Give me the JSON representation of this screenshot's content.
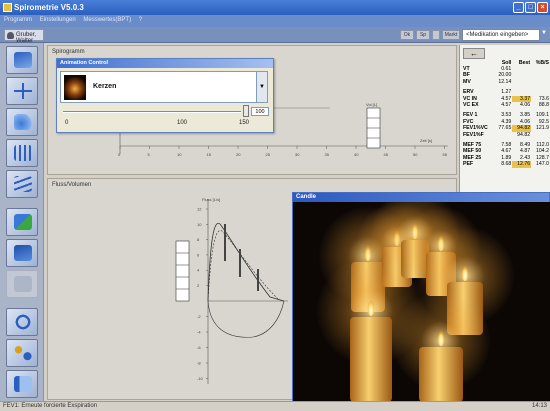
{
  "window": {
    "title": "Spirometrie V5.0.3"
  },
  "menu": [
    "Programm",
    "Einstellungen",
    "Messwertes(BPT)",
    "?"
  ],
  "user": {
    "name": "Gruber, Walter"
  },
  "toolbar_top": {
    "btn1": "Ok",
    "btn2": "Sp",
    "btn3": "Markt"
  },
  "medication": {
    "value": "<Medikation eingeben>"
  },
  "spiro": {
    "label": "Spirogramm",
    "x_ticks": [
      "0",
      "5",
      "10",
      "15",
      "20",
      "25",
      "30",
      "35",
      "40",
      "45",
      "50",
      "55"
    ],
    "axis_label": "Zeit [s]",
    "col_label": "Vol [L]"
  },
  "flow": {
    "label": "Fluss/Volumen",
    "y_label": "Fluss [L/s]",
    "y_ticks": [
      "12",
      "10",
      "8",
      "6",
      "4",
      "2",
      "-2",
      "-4",
      "-6",
      "-8",
      "-10"
    ]
  },
  "animation": {
    "caption": "Animation Control",
    "selected": "Kerzen",
    "slider_value": "100",
    "slider_ticks": [
      "0",
      "100",
      "150"
    ]
  },
  "candle_window": {
    "caption": "Candle"
  },
  "results": {
    "headers": [
      "Soll",
      "Best",
      "%B/S"
    ],
    "rows": [
      {
        "name": "VT",
        "soll": "0.61",
        "best": "",
        "pct": "",
        "hl": false
      },
      {
        "name": "BF",
        "soll": "20.00",
        "best": "",
        "pct": "",
        "hl": false
      },
      {
        "name": "MV",
        "soll": "12.14",
        "best": "",
        "pct": "",
        "hl": false
      },
      {
        "gap": true
      },
      {
        "name": "ERV",
        "soll": "1.27",
        "best": "",
        "pct": "",
        "hl": false
      },
      {
        "name": "VC IN",
        "soll": "4.57",
        "best": "3.37",
        "pct": "73.6",
        "hl": true
      },
      {
        "name": "VC EX",
        "soll": "4.57",
        "best": "4.06",
        "pct": "88.8",
        "hl": false
      },
      {
        "gap": true
      },
      {
        "name": "FEV 1",
        "soll": "3.53",
        "best": "3.85",
        "pct": "109.1",
        "hl": false
      },
      {
        "name": "FVC",
        "soll": "4.39",
        "best": "4.06",
        "pct": "92.5",
        "hl": false
      },
      {
        "name": "FEV1%VC",
        "soll": "77.65",
        "best": "94.82",
        "pct": "121.9",
        "hl": true
      },
      {
        "name": "FEV1%F",
        "soll": "",
        "best": "94.82",
        "pct": "",
        "hl": false
      },
      {
        "gap": true
      },
      {
        "name": "MEF 75",
        "soll": "7.58",
        "best": "8.49",
        "pct": "112.0",
        "hl": false
      },
      {
        "name": "MEF 50",
        "soll": "4.67",
        "best": "4.87",
        "pct": "104.2",
        "hl": false
      },
      {
        "name": "MEF 25",
        "soll": "1.89",
        "best": "2.43",
        "pct": "128.7",
        "hl": false
      },
      {
        "name": "PEF",
        "soll": "8.68",
        "best": "12.76",
        "pct": "147.0",
        "hl": true
      }
    ]
  },
  "status": {
    "text": "FEV1: Erneute forcierte Exspiration",
    "time": "14:13"
  }
}
